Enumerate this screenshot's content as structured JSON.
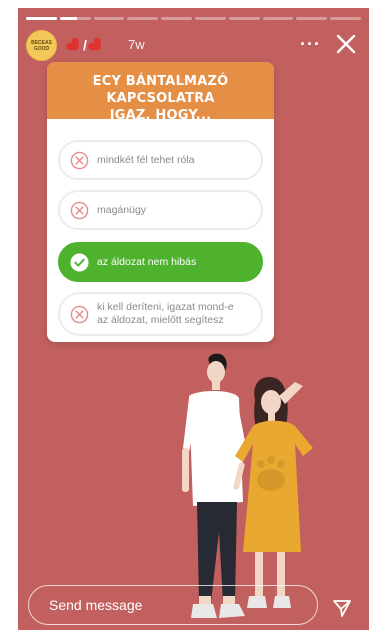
{
  "story": {
    "background": "#c1605e",
    "progress": [
      1,
      0.55,
      0,
      0,
      0,
      0,
      0,
      0,
      0,
      0
    ]
  },
  "header": {
    "avatar_text": "BECEAS\nGOOD",
    "time": "7w",
    "more": "···",
    "icons": [
      "red-heart-icon",
      "red-heart-icon",
      "more-icon",
      "close-icon"
    ]
  },
  "quiz": {
    "title_line1": "ECY BÁNTALMAZÓ KAPCSOLATRA",
    "title_line2": "IGAZ, HOGY...",
    "options": [
      {
        "text": "mindkét fél tehet róla",
        "state": "wrong"
      },
      {
        "text": "magánügy",
        "state": "wrong"
      },
      {
        "text": "az áldozat nem hibás",
        "state": "correct"
      },
      {
        "text_line1": "ki kell deríteni, igazat mond-e",
        "text_line2": "az áldozat, mielőtt segítesz",
        "state": "wrong"
      }
    ],
    "colors": {
      "header": "#e48f45",
      "correct": "#4fb22e",
      "wrong": "#e98a8a"
    }
  },
  "footer": {
    "message_placeholder": "Send message",
    "send_icon": "paper-plane-icon"
  }
}
